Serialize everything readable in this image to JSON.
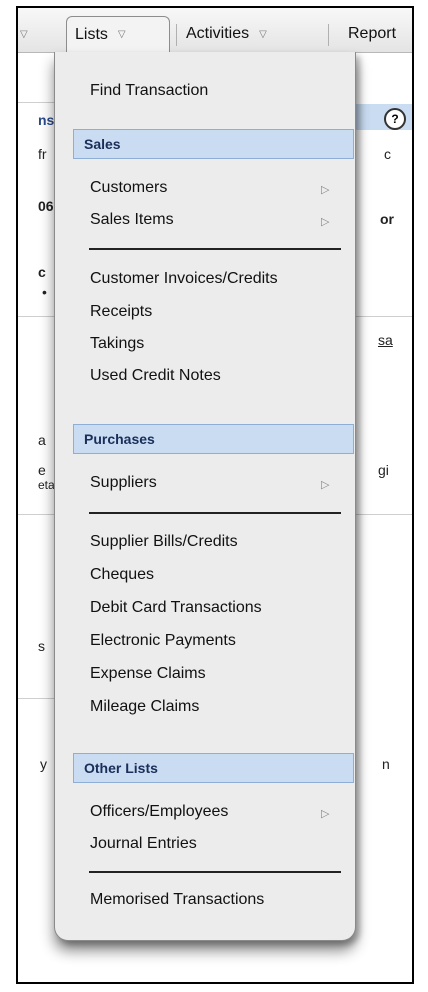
{
  "menubar": {
    "tabs": [
      {
        "label": "Lists"
      },
      {
        "label": "Activities"
      },
      {
        "label": "Report"
      }
    ]
  },
  "background_fragments": {
    "t1": "ns",
    "t2": "fr",
    "t3": "06",
    "t4": "c",
    "t5": "•",
    "t6": "a",
    "t7": "e",
    "t8": "eta",
    "t9": "s",
    "t10": "y",
    "r1": "c",
    "r2": "or",
    "r3": "sa",
    "r4": "gi",
    "r5": "n",
    "help_icon": "?"
  },
  "dropdown": {
    "find_transaction": "Find Transaction",
    "sales_header": "Sales",
    "customers": "Customers",
    "sales_items": "Sales Items",
    "customer_invoices": "Customer Invoices/Credits",
    "receipts": "Receipts",
    "takings": "Takings",
    "used_credit_notes": "Used Credit Notes",
    "purchases_header": "Purchases",
    "suppliers": "Suppliers",
    "supplier_bills": "Supplier Bills/Credits",
    "cheques": "Cheques",
    "debit_card": "Debit Card Transactions",
    "electronic_payments": "Electronic Payments",
    "expense_claims": "Expense Claims",
    "mileage_claims": "Mileage Claims",
    "other_lists_header": "Other Lists",
    "officers_employees": "Officers/Employees",
    "journal_entries": "Journal Entries",
    "memorised_transactions": "Memorised Transactions"
  },
  "colors": {
    "section_header_bg": "#c9dcf2",
    "section_header_text": "#1a2e5a",
    "menu_bg": "#ececec"
  },
  "icons": {
    "submenu": "triangle-right-icon",
    "dropdown": "chevron-down-icon"
  }
}
